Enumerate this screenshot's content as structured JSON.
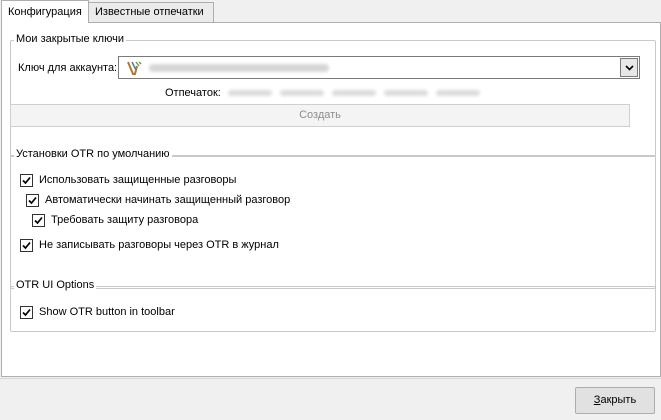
{
  "tabs": [
    {
      "label": "Конфигурация",
      "active": true
    },
    {
      "label": "Известные отпечатки",
      "active": false
    }
  ],
  "private_keys": {
    "legend": "Мои закрытые ключи",
    "account_label": "Ключ для аккаунта:",
    "account_icon": "vacuum-v-logo-icon",
    "fingerprint_label": "Отпечаток:",
    "create_button": "Создать",
    "create_enabled": false
  },
  "defaults": {
    "legend": "Установки OTR по умолчанию",
    "options": [
      {
        "label": "Использовать защищенные разговоры",
        "checked": true
      },
      {
        "label": "Автоматически начинать защищенный разговор",
        "checked": true
      },
      {
        "label": "Требовать защиту разговора",
        "checked": true
      },
      {
        "label": "Не записывать разговоры через OTR в журнал",
        "checked": true
      }
    ]
  },
  "ui_options": {
    "legend": "OTR UI Options",
    "options": [
      {
        "label": "Show OTR button in toolbar",
        "checked": true
      }
    ]
  },
  "footer": {
    "close_mnemonic": "З",
    "close_rest": "акрыть"
  },
  "colors": {
    "panel_bg": "#ffffff",
    "window_bg": "#f0f0f0",
    "disabled_text": "#8c8c8c"
  }
}
